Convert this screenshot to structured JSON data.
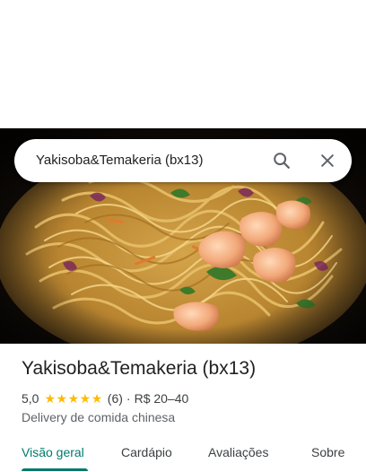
{
  "search": {
    "query": "Yakisoba&Temakeria (bx13)",
    "search_icon": "search-icon",
    "close_icon": "close-icon"
  },
  "hero": {
    "image": "noodle-dish-photo"
  },
  "place": {
    "name": "Yakisoba&Temakeria (bx13)",
    "rating": "5,0",
    "stars": 5,
    "reviews": "(6)",
    "separator": "·",
    "price": "R$ 20–40",
    "category": "Delivery de comida chinesa"
  },
  "tabs": [
    {
      "label": "Visão geral",
      "active": true
    },
    {
      "label": "Cardápio",
      "active": false
    },
    {
      "label": "Avaliações",
      "active": false
    },
    {
      "label": "Sobre",
      "active": false
    }
  ],
  "colors": {
    "accent": "#00796b",
    "star": "#fbbc04"
  }
}
